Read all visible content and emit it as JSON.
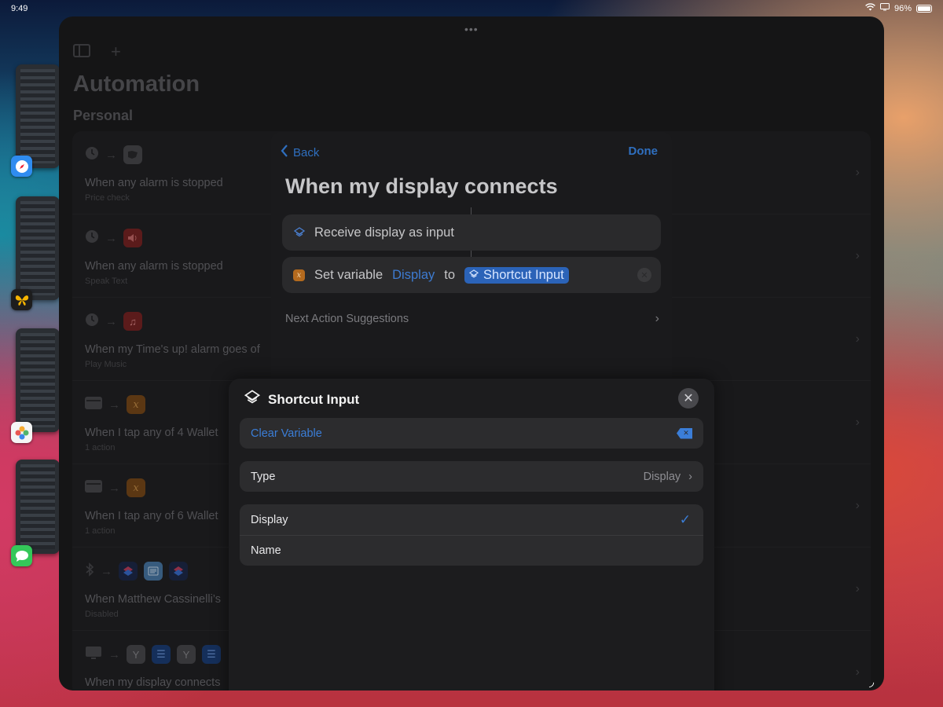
{
  "status_bar": {
    "time": "9:49",
    "battery": "96%"
  },
  "window": {
    "title": "Automation",
    "section": "Personal",
    "rows": [
      {
        "title": "When any alarm is stopped",
        "subtitle": "Price check"
      },
      {
        "title": "When any alarm is stopped",
        "subtitle": "Speak Text"
      },
      {
        "title": "When my Time's up! alarm goes of",
        "subtitle": "Play Music"
      },
      {
        "title": "When I tap any of 4 Wallet",
        "subtitle": "1 action"
      },
      {
        "title": "When I tap any of 6 Wallet",
        "subtitle": "1 action"
      },
      {
        "title": "When Matthew Cassinelli’s",
        "subtitle": "Disabled"
      },
      {
        "title": "When my display connects",
        "subtitle": ""
      }
    ]
  },
  "editor": {
    "back_label": "Back",
    "done_label": "Done",
    "title": "When my display connects",
    "receive_action": "Receive display as input",
    "set_variable": {
      "label": "Set variable",
      "variable": "Display",
      "to": "to",
      "value": "Shortcut Input"
    },
    "next_suggestions": "Next Action Suggestions"
  },
  "popover": {
    "title": "Shortcut Input",
    "clear_label": "Clear Variable",
    "type_label": "Type",
    "type_value": "Display",
    "options": [
      {
        "label": "Display",
        "selected": true
      },
      {
        "label": "Name",
        "selected": false
      }
    ]
  },
  "colors": {
    "accent": "#3b7ed8",
    "variable_pill": "#2b63b8",
    "background": "#1c1c1e"
  }
}
